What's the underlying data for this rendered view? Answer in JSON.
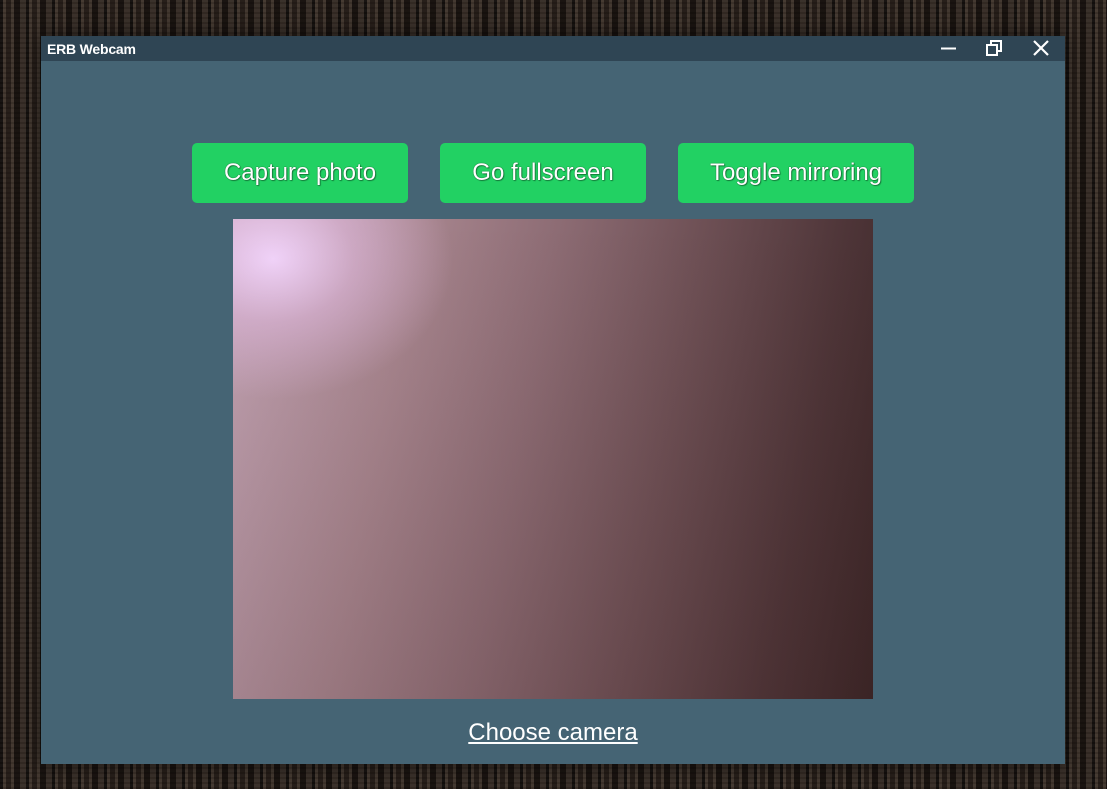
{
  "window": {
    "title": "ERB Webcam",
    "controls": {
      "minimize_icon": "minimize-icon",
      "maximize_icon": "restore-icon",
      "close_icon": "close-icon"
    }
  },
  "toolbar": {
    "capture_label": "Capture photo",
    "fullscreen_label": "Go fullscreen",
    "mirror_label": "Toggle mirroring"
  },
  "camera": {
    "choose_label": "Choose camera"
  },
  "colors": {
    "window_bg": "#456474",
    "titlebar_bg": "#2f4554",
    "button_green": "#22d163"
  }
}
